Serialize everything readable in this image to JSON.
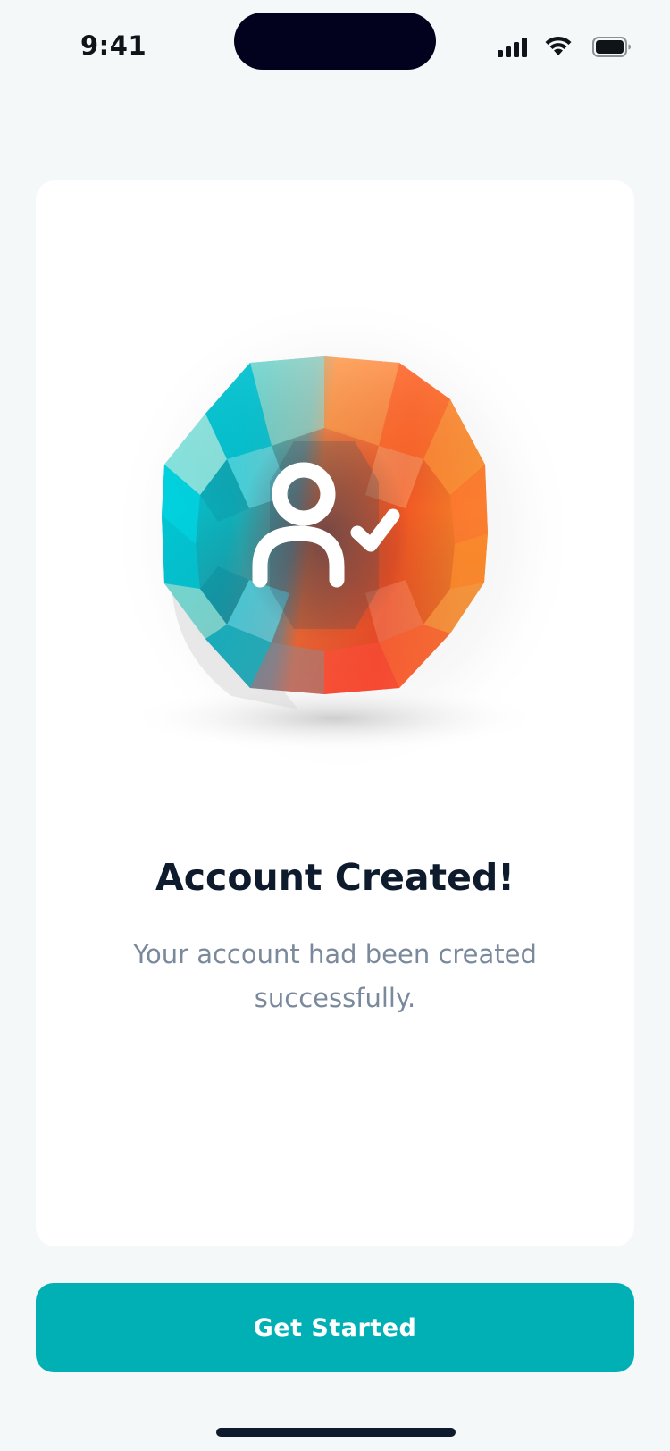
{
  "status_bar": {
    "time": "9:41",
    "icons": [
      "cellular-signal-icon",
      "wifi-icon",
      "battery-icon"
    ]
  },
  "illustration": {
    "icon": "user-check-icon",
    "colors": {
      "teal": "#00c8d6",
      "orange": "#ff7a2e",
      "red": "#ff4f3a"
    }
  },
  "content": {
    "title": "Account Created!",
    "subtitle": "Your account had been created successfully."
  },
  "actions": {
    "get_started_label": "Get Started"
  },
  "colors": {
    "background": "#f5f8f9",
    "card": "#ffffff",
    "accent": "#01b0b5",
    "title": "#0e1b2c",
    "subtitle": "#7a8a9c"
  }
}
